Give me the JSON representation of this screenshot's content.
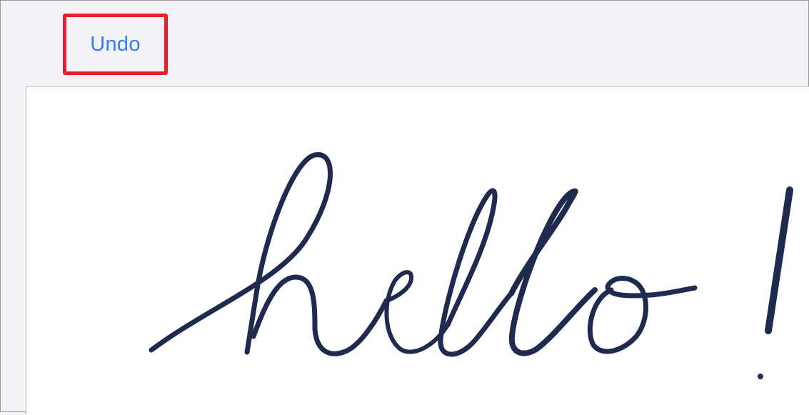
{
  "toolbar": {
    "undo_label": "Undo"
  },
  "annotation": {
    "highlight_color": "#e5202a",
    "arrow_icon": "arrow-up-icon"
  },
  "drawing": {
    "ink_color": "#1f2a4f",
    "handwritten_text": "hello !"
  }
}
